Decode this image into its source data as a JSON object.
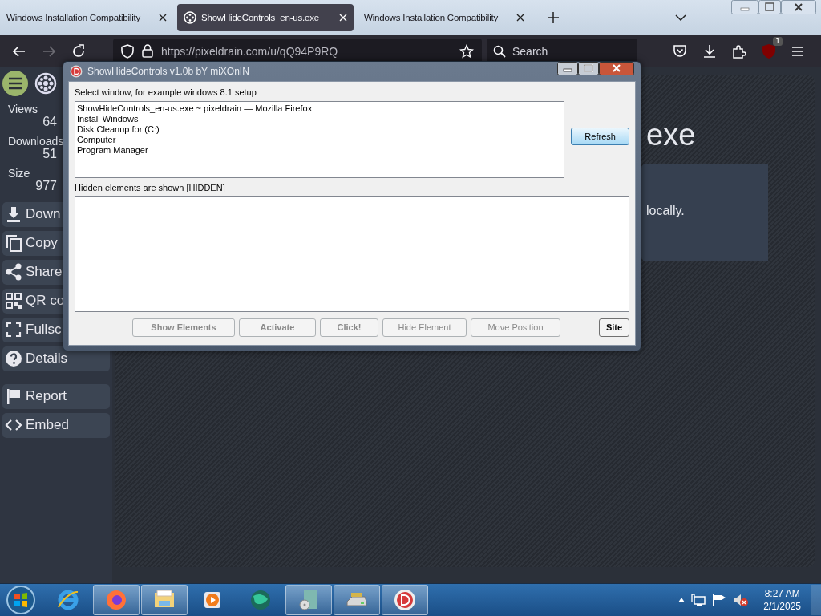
{
  "browser": {
    "tabs": [
      {
        "title": "Windows Installation Compatibility",
        "selected": false,
        "favicon": false
      },
      {
        "title": "ShowHideControls_en-us.exe",
        "selected": true,
        "favicon": true
      },
      {
        "title": "Windows Installation Compatibility",
        "selected": false,
        "favicon": false
      }
    ],
    "nav": [
      {
        "kind": "back",
        "disabled": false
      },
      {
        "kind": "forward",
        "disabled": true
      },
      {
        "kind": "reload",
        "disabled": false
      }
    ],
    "url": "https://pixeldrain.com/u/qQ94P9RQ",
    "search_placeholder": "Search",
    "badge": "1"
  },
  "page": {
    "stats": [
      {
        "label": "Views",
        "value": "64"
      },
      {
        "label": "Downloads",
        "value": "51"
      },
      {
        "label": "Size",
        "value": "977"
      }
    ],
    "actions": [
      {
        "kind": "download",
        "label": "Down"
      },
      {
        "kind": "copy",
        "label": "Copy"
      },
      {
        "kind": "share",
        "label": "Share"
      },
      {
        "kind": "qr",
        "label": "QR co"
      },
      {
        "kind": "fullscreen",
        "label": "Fullsc"
      },
      {
        "kind": "details",
        "label": "Details"
      },
      {
        "kind": "report",
        "label": "Report"
      },
      {
        "kind": "embed",
        "label": "Embed"
      }
    ],
    "title": "exe",
    "note": "locally."
  },
  "dialog": {
    "title": "ShowHideControls v1.0b bY miXOnIN",
    "select_label": "Select window, for example windows 8.1 setup",
    "windows": [
      "ShowHideControls_en-us.exe ~ pixeldrain — Mozilla Firefox",
      "Install Windows",
      "Disk Cleanup for  (C:)",
      "Computer",
      "Program Manager"
    ],
    "refresh": "Refresh",
    "hidden_label": "Hidden elements are shown [HIDDEN]",
    "buttons": [
      {
        "label": "Show Elements",
        "disabled": true
      },
      {
        "label": "Activate",
        "disabled": true
      },
      {
        "label": "Click!",
        "disabled": true
      },
      {
        "label": "Hide Element",
        "disabled": true
      },
      {
        "label": "Move Position",
        "disabled": true
      }
    ],
    "site": "Site"
  },
  "taskbar": {
    "apps": [
      {
        "kind": "ie",
        "running": false
      },
      {
        "kind": "firefox",
        "running": true
      },
      {
        "kind": "explorer",
        "running": true
      },
      {
        "kind": "media",
        "running": false
      },
      {
        "kind": "globe",
        "running": false
      },
      {
        "kind": "installer",
        "running": true
      },
      {
        "kind": "drive",
        "running": true
      },
      {
        "kind": "d-app",
        "running": true
      }
    ],
    "time": "8:27 AM",
    "date": "2/1/2025"
  }
}
